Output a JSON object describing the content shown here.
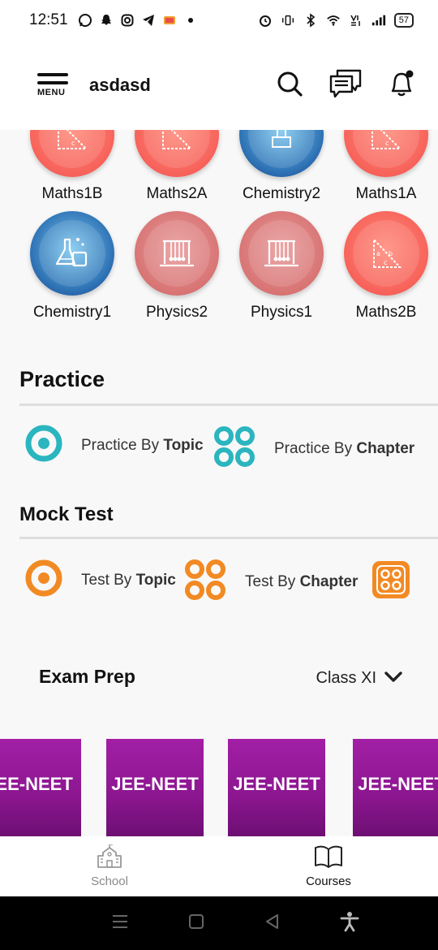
{
  "status_bar": {
    "time": "12:51",
    "battery": "57",
    "left_icons": [
      "whatsapp-icon",
      "snapchat-icon",
      "instagram-icon",
      "telegram-icon",
      "app-icon",
      "dot-icon"
    ],
    "right_icons": [
      "alarm-icon",
      "vibrate-icon",
      "bluetooth-icon",
      "wifi-icon",
      "volte-icon",
      "signal-icon"
    ]
  },
  "header": {
    "menu_label": "MENU",
    "title": "asdasd",
    "actions": [
      "search-icon",
      "chat-icon",
      "bell-icon"
    ]
  },
  "subjects": [
    {
      "label": "Maths1B",
      "icon": "triangle-icon",
      "style": "red"
    },
    {
      "label": "Maths2A",
      "icon": "triangle-icon",
      "style": "red"
    },
    {
      "label": "Chemistry2",
      "icon": "flask-icon",
      "style": "blue"
    },
    {
      "label": "Maths1A",
      "icon": "triangle-icon",
      "style": "red"
    },
    {
      "label": "Chemistry1",
      "icon": "flask-icon",
      "style": "blue"
    },
    {
      "label": "Physics2",
      "icon": "pendulum-icon",
      "style": "pink"
    },
    {
      "label": "Physics1",
      "icon": "pendulum-icon",
      "style": "pink"
    },
    {
      "label": "Maths2B",
      "icon": "triangle-icon",
      "style": "red"
    }
  ],
  "practice": {
    "title": "Practice",
    "by_topic_prefix": "Practice By ",
    "by_topic_bold": "Topic",
    "by_chapter_prefix": "Practice By ",
    "by_chapter_bold": "Chapter",
    "color": "#2bb5bf"
  },
  "mock_test": {
    "title": "Mock Test",
    "by_topic_prefix": "Test By ",
    "by_topic_bold": "Topic",
    "by_chapter_prefix": "Test By ",
    "by_chapter_bold": "Chapter",
    "color": "#f28a24"
  },
  "exam_prep": {
    "title": "Exam Prep",
    "class_selected": "Class XI",
    "cards": [
      "JEE-NEET",
      "JEE-NEET",
      "JEE-NEET",
      "JEE-NEET"
    ]
  },
  "tabs": [
    {
      "label": "School",
      "icon": "school-icon",
      "active": false
    },
    {
      "label": "Courses",
      "icon": "book-icon",
      "active": true
    }
  ],
  "colors": {
    "accent_teal": "#2bb5bf",
    "accent_orange": "#f28a24",
    "card_purple": "#8b168f"
  }
}
